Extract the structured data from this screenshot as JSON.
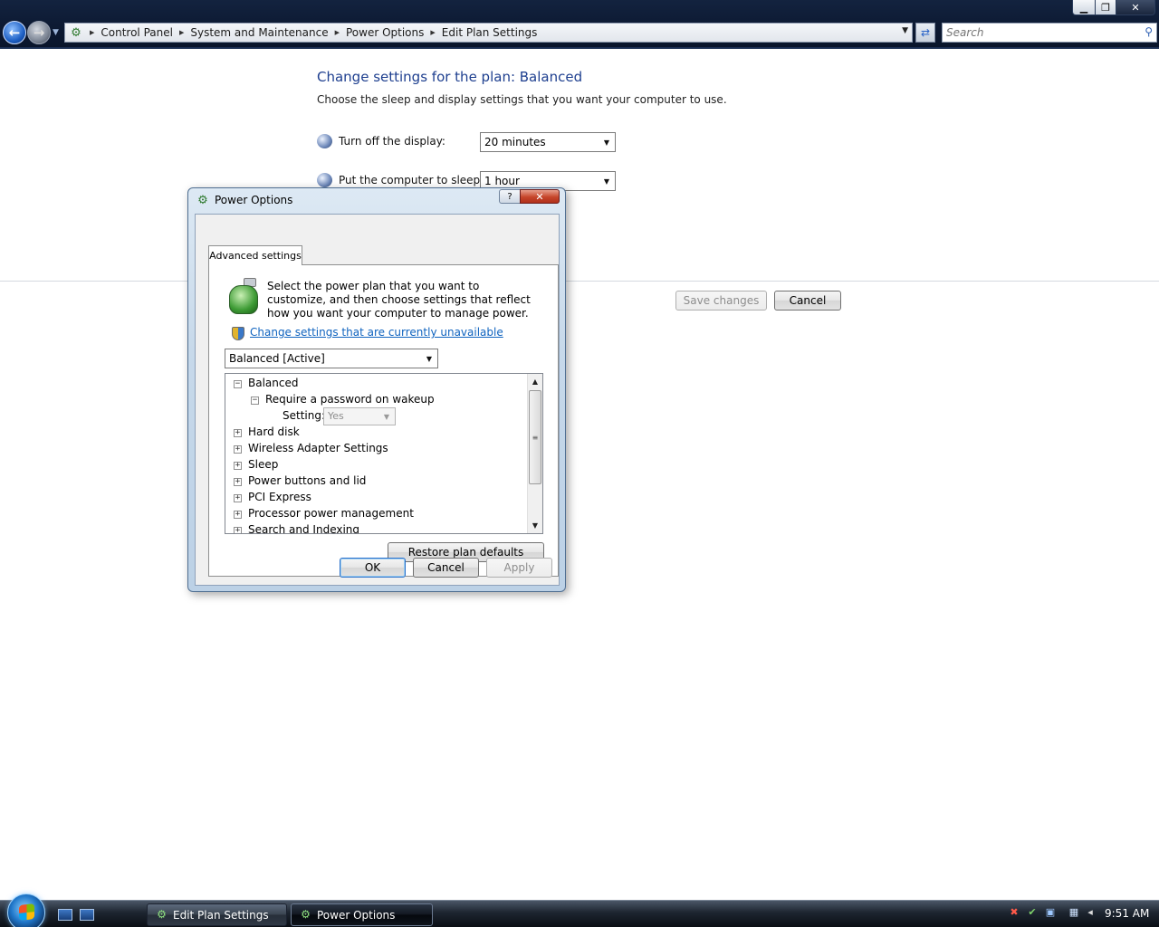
{
  "address": {
    "crumbs": [
      "Control Panel",
      "System and Maintenance",
      "Power Options",
      "Edit Plan Settings"
    ],
    "search_placeholder": "Search"
  },
  "window_controls": {
    "minimize": "▁",
    "maximize": "❐",
    "close": "✕"
  },
  "page": {
    "title": "Change settings for the plan: Balanced",
    "description": "Choose the sleep and display settings that you want your computer to use.",
    "settings": [
      {
        "label": "Turn off the display:",
        "value": "20 minutes"
      },
      {
        "label": "Put the computer to sleep:",
        "value": "1 hour"
      }
    ],
    "save_label": "Save changes",
    "cancel_label": "Cancel"
  },
  "dialog": {
    "title": "Power Options",
    "help": "?",
    "close": "✕",
    "tab": "Advanced settings",
    "intro": "Select the power plan that you want to customize, and then choose settings that reflect how you want your computer to manage power.",
    "change_link": "Change settings that are currently unavailable",
    "plan_value": "Balanced [Active]",
    "tree": {
      "root": "Balanced",
      "child": "Require a password on wakeup",
      "setting_label": "Setting:",
      "setting_value": "Yes",
      "items": [
        "Hard disk",
        "Wireless Adapter Settings",
        "Sleep",
        "Power buttons and lid",
        "PCI Express",
        "Processor power management",
        "Search and Indexing"
      ]
    },
    "restore_label": "Restore plan defaults",
    "ok_label": "OK",
    "cancel_label": "Cancel",
    "apply_label": "Apply"
  },
  "taskbar": {
    "tasks": [
      {
        "label": "Edit Plan Settings",
        "active": false
      },
      {
        "label": "Power Options",
        "active": true
      }
    ],
    "clock": "9:51 AM"
  },
  "colors": {
    "link": "#0f63bf",
    "title": "#1e3f8f"
  }
}
